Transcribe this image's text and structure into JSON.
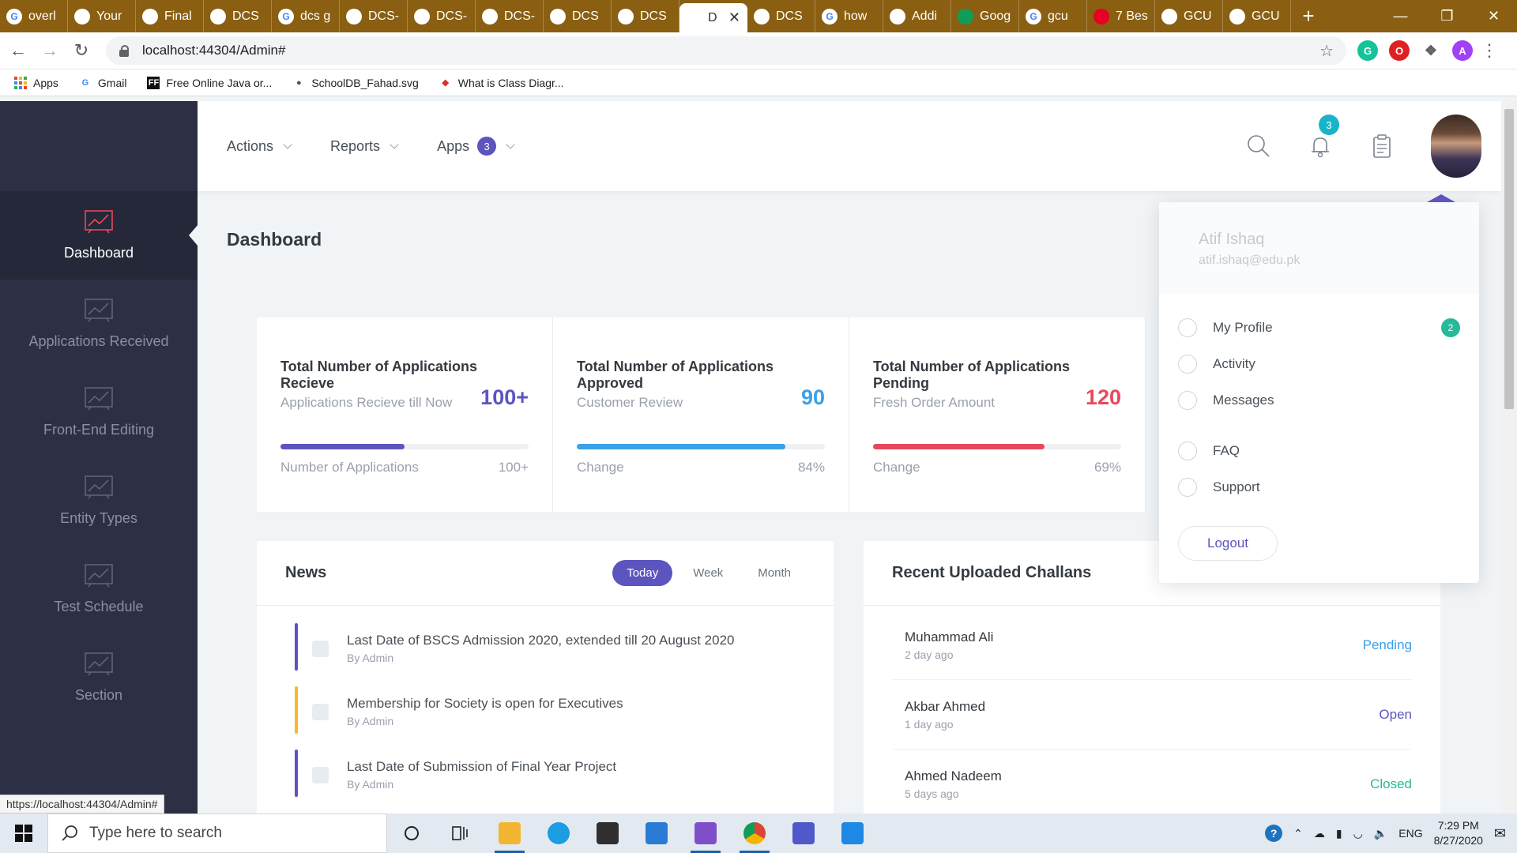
{
  "browser": {
    "tabs": [
      {
        "title": "overl",
        "icon": "google-icon",
        "active": false
      },
      {
        "title": "Your",
        "icon": "leaf-icon",
        "active": false
      },
      {
        "title": "Final",
        "icon": "leaf-icon",
        "active": false
      },
      {
        "title": "DCS",
        "icon": "shield-icon",
        "active": false
      },
      {
        "title": "dcs g",
        "icon": "google-icon",
        "active": false
      },
      {
        "title": "DCS-",
        "icon": "shield-icon",
        "active": false
      },
      {
        "title": "DCS-",
        "icon": "shield-icon",
        "active": false
      },
      {
        "title": "DCS-",
        "icon": "shield-icon",
        "active": false
      },
      {
        "title": "DCS",
        "icon": "shield-icon",
        "active": false
      },
      {
        "title": "DCS",
        "icon": "shield-icon",
        "active": false
      },
      {
        "title": "D",
        "icon": "shield-icon",
        "active": true
      },
      {
        "title": "DCS",
        "icon": "shield-icon",
        "active": false
      },
      {
        "title": "how",
        "icon": "google-icon",
        "active": false
      },
      {
        "title": "Addi",
        "icon": "addin-icon",
        "active": false
      },
      {
        "title": "Goog",
        "icon": "sheets-icon",
        "active": false
      },
      {
        "title": "gcu",
        "icon": "google-icon",
        "active": false
      },
      {
        "title": "7 Bes",
        "icon": "pinterest-icon",
        "active": false
      },
      {
        "title": "GCU",
        "icon": "gcu-icon",
        "active": false
      },
      {
        "title": "GCU",
        "icon": "gcu-icon",
        "active": false
      }
    ],
    "url": "localhost:44304/Admin#",
    "status_url": "https://localhost:44304/Admin#",
    "bookmarks": [
      {
        "label": "Apps",
        "icon": "apps-grid-icon"
      },
      {
        "label": "Gmail",
        "icon": "google-icon"
      },
      {
        "label": "Free Online Java or...",
        "icon": "ff-icon"
      },
      {
        "label": "SchoolDB_Fahad.svg",
        "icon": "globe-icon"
      },
      {
        "label": "What is Class Diagr...",
        "icon": "diamond-icon"
      }
    ]
  },
  "sidebar": {
    "items": [
      {
        "label": "Dashboard",
        "active": true
      },
      {
        "label": "Applications Received",
        "active": false
      },
      {
        "label": "Front-End Editing",
        "active": false
      },
      {
        "label": "Entity Types",
        "active": false
      },
      {
        "label": "Test Schedule",
        "active": false
      },
      {
        "label": "Section",
        "active": false
      }
    ]
  },
  "header": {
    "menu": {
      "actions": "Actions",
      "reports": "Reports",
      "apps": "Apps",
      "apps_count": "3"
    },
    "notification_count": "3"
  },
  "page": {
    "title": "Dashboard"
  },
  "stats": [
    {
      "title": "Total Number of Applications Recieve",
      "subtitle": "Applications Recieve till Now",
      "value": "100+",
      "value_color": "#5c55bf",
      "bar_color": "#5c55bf",
      "progress": 0.5,
      "foot_label": "Number of Applications",
      "foot_value": "100+"
    },
    {
      "title": "Total Number of Applications Approved",
      "subtitle": "Customer Review",
      "value": "90",
      "value_color": "#3aa0e8",
      "bar_color": "#3aa0e8",
      "progress": 0.84,
      "foot_label": "Change",
      "foot_value": "84%"
    },
    {
      "title": "Total Number of Applications Pending",
      "subtitle": "Fresh Order Amount",
      "value": "120",
      "value_color": "#e8485d",
      "bar_color": "#e8485d",
      "progress": 0.69,
      "foot_label": "Change",
      "foot_value": "69%"
    }
  ],
  "news": {
    "title": "News",
    "filters": [
      "Today",
      "Week",
      "Month"
    ],
    "active_filter": "Today",
    "items": [
      {
        "text": "Last Date of BSCS Admission 2020, extended till 20 August 2020",
        "by": "By Admin",
        "color": "#5c55bf"
      },
      {
        "text": "Membership for Society is open for Executives",
        "by": "By Admin",
        "color": "#f7b924"
      },
      {
        "text": "Last Date of Submission of Final Year Project",
        "by": "By Admin",
        "color": "#5c55bf"
      }
    ]
  },
  "challans": {
    "title": "Recent Uploaded Challans",
    "rows": [
      {
        "name": "Muhammad Ali",
        "time": "2 day ago",
        "status": "Pending",
        "status_color": "#3aa0e8"
      },
      {
        "name": "Akbar Ahmed",
        "time": "1 day ago",
        "status": "Open",
        "status_color": "#5c55bf"
      },
      {
        "name": "Ahmed Nadeem",
        "time": "5 days ago",
        "status": "Closed",
        "status_color": "#26b99a"
      }
    ]
  },
  "profile_menu": {
    "name": "Atif Ishaq",
    "email": "atif.ishaq@edu.pk",
    "items": [
      {
        "label": "My Profile",
        "badge": "2"
      },
      {
        "label": "Activity",
        "badge": ""
      },
      {
        "label": "Messages",
        "badge": ""
      },
      {
        "label": "FAQ",
        "badge": ""
      },
      {
        "label": "Support",
        "badge": ""
      }
    ],
    "logout": "Logout"
  },
  "taskbar": {
    "search_placeholder": "Type here to search",
    "language": "ENG",
    "time": "7:29 PM",
    "date": "8/27/2020"
  }
}
